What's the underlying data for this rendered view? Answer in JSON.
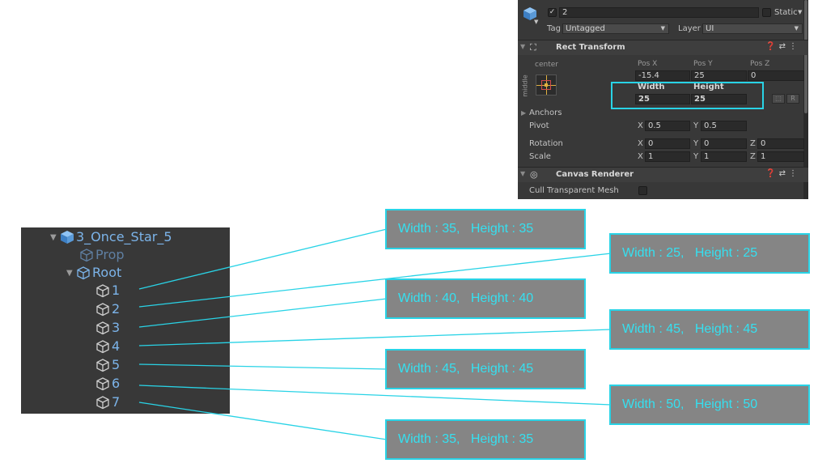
{
  "inspector": {
    "object_name": "2",
    "static_label": "Static",
    "tag_label": "Tag",
    "tag_value": "Untagged",
    "layer_label": "Layer",
    "layer_value": "UI",
    "rect_transform": {
      "title": "Rect Transform",
      "anchor_preset_h": "center",
      "anchor_preset_v": "middle",
      "pos_x_label": "Pos X",
      "pos_x": "-15.4",
      "pos_y_label": "Pos Y",
      "pos_y": "25",
      "pos_z_label": "Pos Z",
      "pos_z": "0",
      "width_label": "Width",
      "width": "25",
      "height_label": "Height",
      "height": "25",
      "raw_btn": "R",
      "anchors_label": "Anchors",
      "pivot_label": "Pivot",
      "pivot_x_label": "X",
      "pivot_x": "0.5",
      "pivot_y_label": "Y",
      "pivot_y": "0.5",
      "rotation_label": "Rotation",
      "rot_x": "0",
      "rot_y": "0",
      "rot_z": "0",
      "scale_label": "Scale",
      "scale_x": "1",
      "scale_y": "1",
      "scale_z": "1",
      "x_label": "X",
      "y_label": "Y",
      "z_label": "Z"
    },
    "canvas_renderer": {
      "title": "Canvas Renderer",
      "cull_label": "Cull Transparent Mesh"
    }
  },
  "hierarchy": {
    "root_object": "3_Once_Star_5",
    "prop": "Prop",
    "root": "Root",
    "items": [
      "1",
      "2",
      "3",
      "4",
      "5",
      "6",
      "7"
    ]
  },
  "callouts": [
    {
      "item": "1",
      "text": "Width : 35,   Height : 35"
    },
    {
      "item": "2",
      "text": "Width : 25,   Height : 25"
    },
    {
      "item": "3",
      "text": "Width : 40,   Height : 40"
    },
    {
      "item": "4",
      "text": "Width : 45,   Height : 45"
    },
    {
      "item": "5",
      "text": "Width : 45,   Height : 45"
    },
    {
      "item": "6",
      "text": "Width : 50,   Height : 50"
    },
    {
      "item": "7",
      "text": "Width : 35,   Height : 35"
    }
  ],
  "colors": {
    "accent": "#29d3e6",
    "callout_bg": "#858585",
    "callout_text": "#35e0f0",
    "panel_bg": "#383838",
    "hierarchy_text": "#d0d0d0",
    "prefab_blue": "#7cb4ea",
    "prop_dim": "#5f7fa2"
  }
}
